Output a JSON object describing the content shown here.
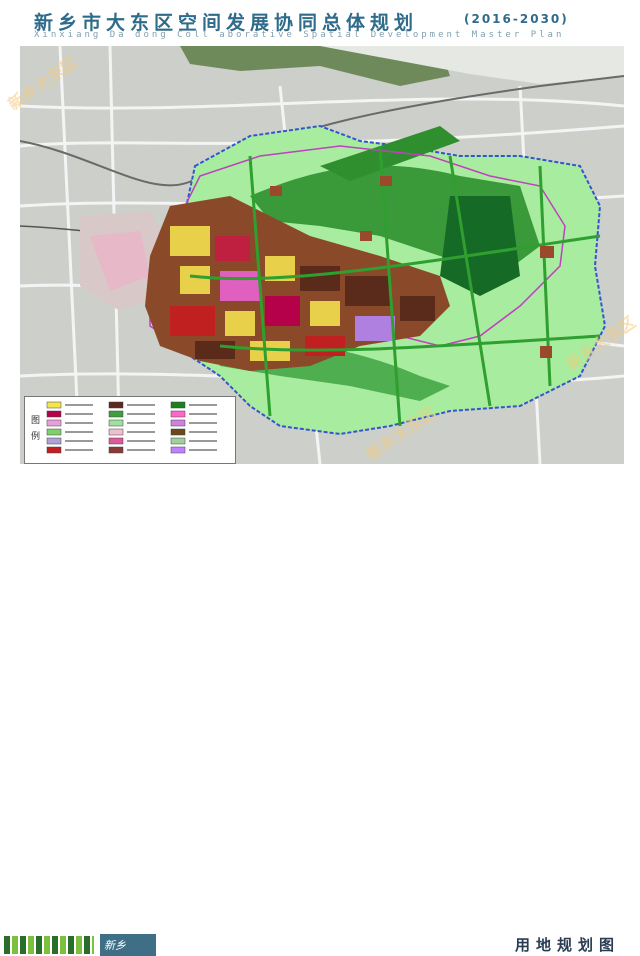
{
  "header": {
    "title": "新乡市大东区空间发展协同总体规划",
    "years": "(2016-2030)",
    "subtitle": "Xinxiang Da dong Coll aborative Spatial Development Master Plan"
  },
  "legend": {
    "title": "图例",
    "swatch_colors": [
      "#f5e54a",
      "#b5004a",
      "#e9a0d8",
      "#7fd06a",
      "#b0a0d8",
      "#c02020",
      "#5a2a1a",
      "#3f9f3f",
      "#9fe09f",
      "#f0c0d0",
      "#e05a9a",
      "#8a3a3a",
      "#1f7f1f",
      "#ff66cc",
      "#d080e0",
      "#6a4a1a",
      "#a0d0a0",
      "#c080ff"
    ]
  },
  "footer": {
    "logo_text": "新乡",
    "plan_name": "用地规划图"
  },
  "colors": {
    "green_space": "#9fe89f",
    "forest": "#2e8b2e",
    "boundary": "#3355cc",
    "urban": "#5a2a1a",
    "residential": "#e8d04a"
  },
  "watermark_text": "新乡大东区"
}
